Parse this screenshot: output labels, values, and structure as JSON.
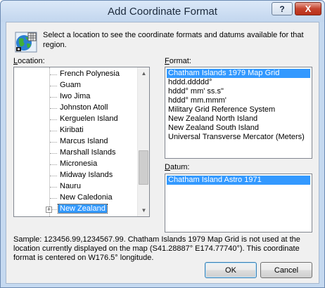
{
  "window": {
    "title": "Add Coordinate Format",
    "help_label": "?",
    "close_label": "X"
  },
  "intro": "Select a location to see the coordinate formats and datums available for that region.",
  "location": {
    "label_prefix": "",
    "label_key": "L",
    "label_rest": "ocation:",
    "items": [
      {
        "label": "French Polynesia"
      },
      {
        "label": "Guam"
      },
      {
        "label": "Iwo Jima"
      },
      {
        "label": "Johnston Atoll"
      },
      {
        "label": "Kerguelen Island"
      },
      {
        "label": "Kiribati"
      },
      {
        "label": "Marcus Island"
      },
      {
        "label": "Marshall Islands"
      },
      {
        "label": "Micronesia"
      },
      {
        "label": "Midway Islands"
      },
      {
        "label": "Nauru"
      },
      {
        "label": "New Caledonia"
      },
      {
        "label": "New Zealand",
        "selected": true,
        "expander": "+"
      }
    ]
  },
  "format": {
    "label_key": "F",
    "label_rest": "ormat:",
    "items": [
      {
        "label": "Chatham Islands 1979 Map Grid",
        "selected": true
      },
      {
        "label": "hddd.ddddd°"
      },
      {
        "label": "hddd° mm' ss.s\""
      },
      {
        "label": "hddd° mm.mmm'"
      },
      {
        "label": "Military Grid Reference System"
      },
      {
        "label": "New Zealand North Island"
      },
      {
        "label": "New Zealand South Island"
      },
      {
        "label": "Universal Transverse Mercator (Meters)"
      }
    ]
  },
  "datum": {
    "label_key": "D",
    "label_rest": "atum:",
    "items": [
      {
        "label": "Chatham Island Astro 1971",
        "selected": true
      }
    ]
  },
  "sample_text": "Sample: 123456.99,1234567.99.  Chatham Islands 1979 Map Grid is not used at the location currently displayed on the map (S41.28887° E174.77740°).  This coordinate format is centered on W176.5° longitude.",
  "buttons": {
    "ok": "OK",
    "cancel": "Cancel"
  },
  "scroll": {
    "up_glyph": "▲",
    "down_glyph": "▼"
  },
  "icons": {
    "app": "globe-grid-icon"
  },
  "colors": {
    "selection": "#3399ff",
    "title_bar": "#c5d9f0",
    "close_button": "#c5432d"
  }
}
